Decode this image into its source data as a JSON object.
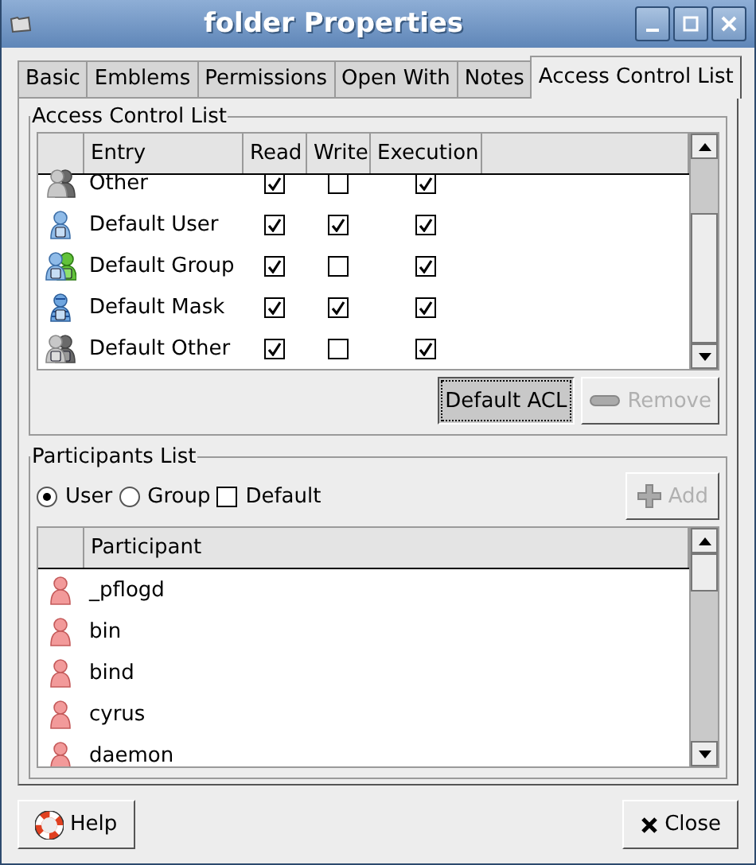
{
  "window": {
    "title": "folder Properties"
  },
  "tabs": [
    {
      "label": "Basic",
      "selected": false
    },
    {
      "label": "Emblems",
      "selected": false
    },
    {
      "label": "Permissions",
      "selected": false
    },
    {
      "label": "Open With",
      "selected": false
    },
    {
      "label": "Notes",
      "selected": false
    },
    {
      "label": "Access Control List",
      "selected": true
    }
  ],
  "acl": {
    "title": "Access Control List",
    "columns": [
      "Entry",
      "Read",
      "Write",
      "Execution"
    ],
    "rows": [
      {
        "kind": "other",
        "entry": "Other",
        "read": true,
        "write": false,
        "execution": true
      },
      {
        "kind": "default-user",
        "entry": "Default User",
        "read": true,
        "write": true,
        "execution": true
      },
      {
        "kind": "default-group",
        "entry": "Default Group",
        "read": true,
        "write": false,
        "execution": true
      },
      {
        "kind": "default-mask",
        "entry": "Default Mask",
        "read": true,
        "write": true,
        "execution": true
      },
      {
        "kind": "default-other",
        "entry": "Default Other",
        "read": true,
        "write": false,
        "execution": true
      }
    ],
    "buttons": [
      {
        "label": "Default ACL",
        "disabled": false,
        "focused": true
      },
      {
        "label": "Remove",
        "disabled": true,
        "focused": false
      }
    ]
  },
  "participants": {
    "title": "Participants List",
    "options": [
      {
        "kind": "radio",
        "label": "User",
        "selected": true
      },
      {
        "kind": "radio",
        "label": "Group",
        "selected": false
      },
      {
        "kind": "checkbox",
        "label": "Default",
        "selected": false
      }
    ],
    "add_button": {
      "label": "Add",
      "disabled": true
    },
    "column": "Participant",
    "rows": [
      "_pflogd",
      "bin",
      "bind",
      "cyrus",
      "daemon"
    ]
  },
  "footer": {
    "help": "Help",
    "close": "Close"
  }
}
